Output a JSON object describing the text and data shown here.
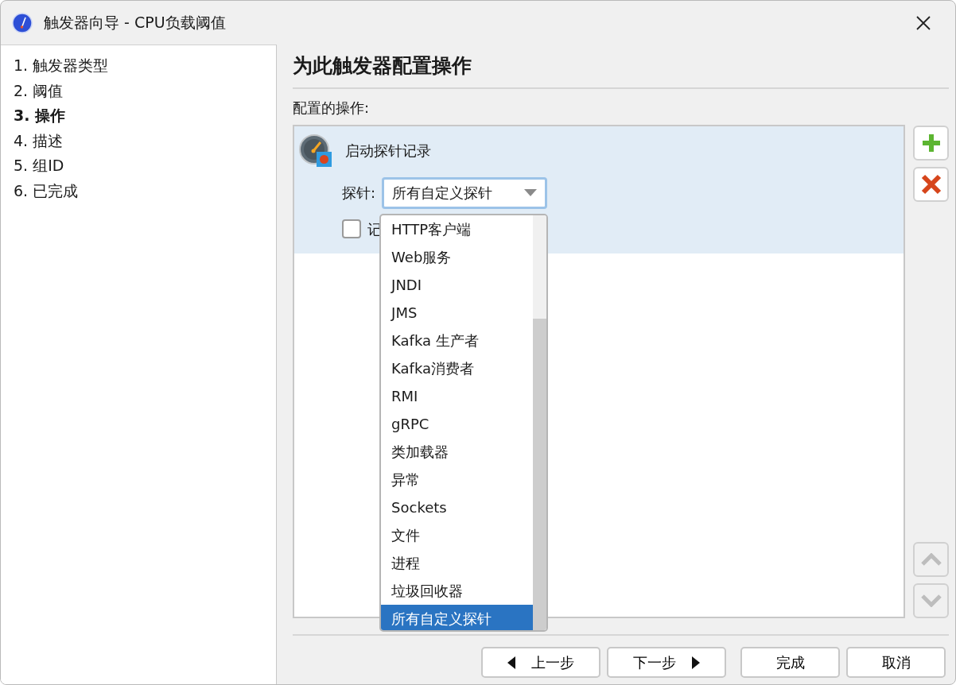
{
  "window": {
    "title": "触发器向导 - CPU负载阈值"
  },
  "steps": [
    {
      "label": "1. 触发器类型",
      "selected": false
    },
    {
      "label": "2. 阈值",
      "selected": false
    },
    {
      "label": "3. 操作",
      "selected": true
    },
    {
      "label": "4. 描述",
      "selected": false
    },
    {
      "label": "5. 组ID",
      "selected": false
    },
    {
      "label": "6. 已完成",
      "selected": false
    }
  ],
  "heading": "为此触发器配置操作",
  "actions_label": "配置的操作:",
  "actions": [
    {
      "title": "启动探针记录",
      "selected": true,
      "probe_label": "探针:",
      "probe_value": "所有自定义探针",
      "checkbox": {
        "label": "记",
        "checked": false
      }
    }
  ],
  "dropdown": {
    "items": [
      {
        "label": "HTTP客户端",
        "selected": false
      },
      {
        "label": "Web服务",
        "selected": false
      },
      {
        "label": "JNDI",
        "selected": false
      },
      {
        "label": "JMS",
        "selected": false
      },
      {
        "label": "Kafka 生产者",
        "selected": false
      },
      {
        "label": "Kafka消费者",
        "selected": false
      },
      {
        "label": "RMI",
        "selected": false
      },
      {
        "label": "gRPC",
        "selected": false
      },
      {
        "label": "类加载器",
        "selected": false
      },
      {
        "label": "异常",
        "selected": false
      },
      {
        "label": "Sockets",
        "selected": false
      },
      {
        "label": "文件",
        "selected": false
      },
      {
        "label": "进程",
        "selected": false
      },
      {
        "label": "垃圾回收器",
        "selected": false
      },
      {
        "label": "所有自定义探针",
        "selected": true
      }
    ]
  },
  "side_buttons": [
    {
      "kind": "add",
      "disabled": false
    },
    {
      "kind": "delete",
      "disabled": false
    },
    {
      "kind": "up",
      "disabled": true
    },
    {
      "kind": "down",
      "disabled": true
    }
  ],
  "footer_buttons": [
    {
      "kind": "back",
      "label": "上一步"
    },
    {
      "kind": "next",
      "label": "下一步"
    },
    {
      "kind": "finish",
      "label": "完成"
    },
    {
      "kind": "cancel",
      "label": "取消"
    }
  ]
}
